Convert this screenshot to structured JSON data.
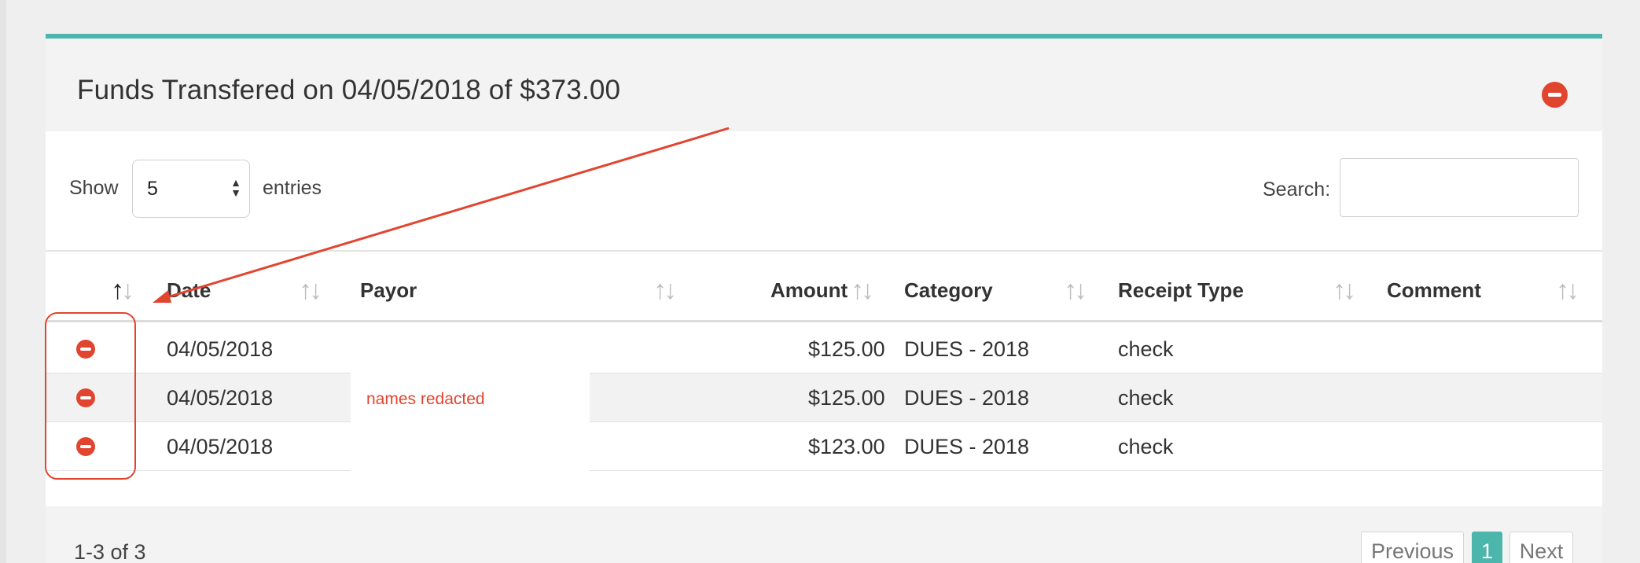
{
  "panel": {
    "title": "Funds Transfered on 04/05/2018 of $373.00",
    "accent_color": "#4db6ac",
    "remove_icon": "minus-circle-icon",
    "remove_color": "#e2452f"
  },
  "controls": {
    "show_label": "Show",
    "entries_value": "5",
    "entries_label": "entries",
    "search_label": "Search:",
    "search_value": ""
  },
  "table": {
    "columns": [
      {
        "label": ""
      },
      {
        "label": "Date"
      },
      {
        "label": "Payor"
      },
      {
        "label": "Amount"
      },
      {
        "label": "Category"
      },
      {
        "label": "Receipt Type"
      },
      {
        "label": "Comment"
      }
    ],
    "rows": [
      {
        "date": "04/05/2018",
        "payor": "",
        "amount": "$125.00",
        "category": "DUES - 2018",
        "receipt_type": "check",
        "comment": ""
      },
      {
        "date": "04/05/2018",
        "payor": "",
        "amount": "$125.00",
        "category": "DUES - 2018",
        "receipt_type": "check",
        "comment": ""
      },
      {
        "date": "04/05/2018",
        "payor": "",
        "amount": "$123.00",
        "category": "DUES - 2018",
        "receipt_type": "check",
        "comment": ""
      }
    ],
    "redaction_note": "names redacted"
  },
  "footer": {
    "record_info": "1-3 of 3",
    "previous_label": "Previous",
    "current_page": "1",
    "next_label": "Next"
  }
}
